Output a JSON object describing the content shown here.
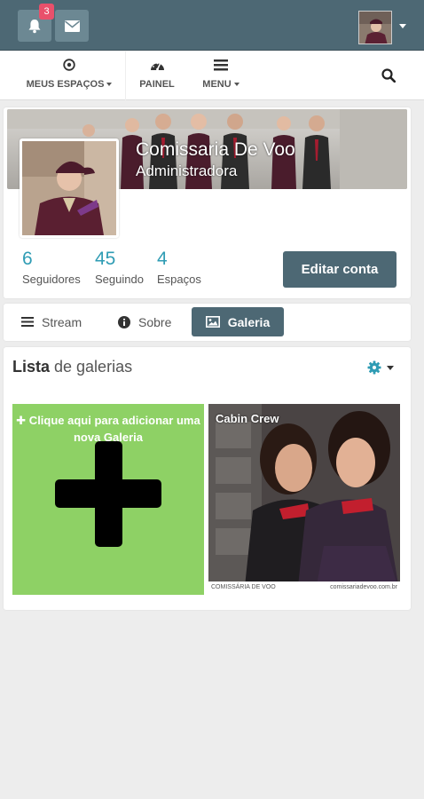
{
  "topbar": {
    "notifications_count": "3",
    "icons": [
      "bell-icon",
      "envelope-icon",
      "caret-down-icon"
    ]
  },
  "nav": {
    "items": [
      {
        "label": "MEUS ESPAÇOS",
        "icon": "target-icon",
        "has_caret": true
      },
      {
        "label": "PAINEL",
        "icon": "dashboard-icon",
        "has_caret": false
      },
      {
        "label": "MENU",
        "icon": "list-icon",
        "has_caret": true
      }
    ],
    "search_icon": "search-icon"
  },
  "profile": {
    "name": "Comissaria De Voo",
    "role": "Administradora",
    "stats": [
      {
        "value": "6",
        "label": "Seguidores"
      },
      {
        "value": "45",
        "label": "Seguindo"
      },
      {
        "value": "4",
        "label": "Espaços"
      }
    ],
    "edit_button": "Editar conta"
  },
  "tabs": [
    {
      "label": "Stream",
      "icon": "bars-icon",
      "active": false
    },
    {
      "label": "Sobre",
      "icon": "info-icon",
      "active": false
    },
    {
      "label": "Galeria",
      "icon": "image-icon",
      "active": true
    }
  ],
  "gallery": {
    "title_bold": "Lista",
    "title_rest": " de galerias",
    "add_text": "✚ Clique aqui para adicionar uma nova Galeria",
    "items": [
      {
        "caption": "Cabin Crew"
      }
    ],
    "footer_left": "COMISSÁRIA DE VOO",
    "footer_right": "comissariadevoo.com.br"
  },
  "colors": {
    "topbar": "#4d6874",
    "accent": "#2f9cb4",
    "badge": "#e9506b",
    "add_tile": "#8ed165"
  }
}
